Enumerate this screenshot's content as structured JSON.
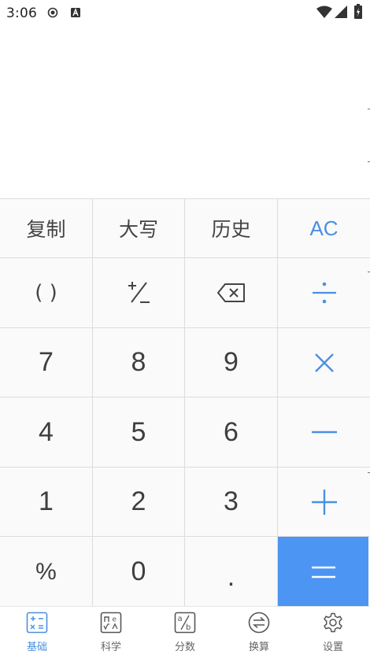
{
  "status_bar": {
    "time": "3:06"
  },
  "keypad": {
    "row1": {
      "copy": "复制",
      "upper": "大写",
      "history": "历史",
      "clear": "AC"
    },
    "row2": {
      "paren": "( )"
    },
    "digits": {
      "seven": "7",
      "eight": "8",
      "nine": "9",
      "four": "4",
      "five": "5",
      "six": "6",
      "one": "1",
      "two": "2",
      "three": "3",
      "zero": "0"
    },
    "percent": "%",
    "decimal": ".",
    "accent_color": "#4a90e2",
    "equals_bg": "#4d95f2"
  },
  "tabbar": {
    "tabs": [
      {
        "label": "基础",
        "icon": "basic-calc-icon",
        "active": true
      },
      {
        "label": "科学",
        "icon": "scientific-icon",
        "active": false
      },
      {
        "label": "分数",
        "icon": "fraction-icon",
        "active": false
      },
      {
        "label": "换算",
        "icon": "convert-icon",
        "active": false
      },
      {
        "label": "设置",
        "icon": "settings-gear-icon",
        "active": false
      }
    ]
  }
}
